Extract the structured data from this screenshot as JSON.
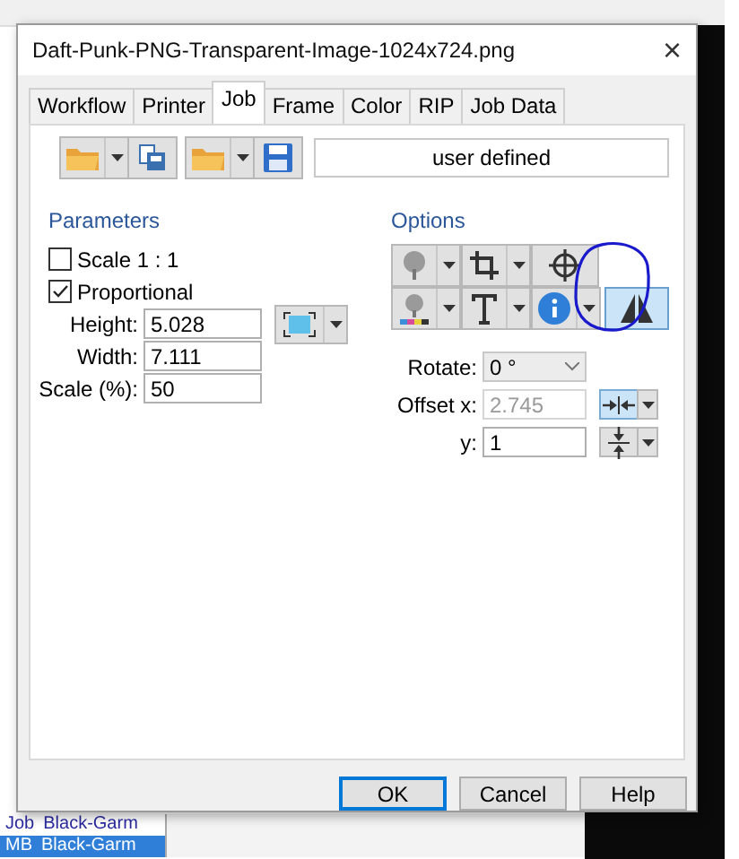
{
  "window": {
    "title": "Daft-Punk-PNG-Transparent-Image-1024x724.png",
    "close": "×"
  },
  "tabs": [
    {
      "label": "Workflow",
      "selected": false
    },
    {
      "label": "Printer",
      "selected": false
    },
    {
      "label": "Job",
      "selected": true
    },
    {
      "label": "Frame",
      "selected": false
    },
    {
      "label": "Color",
      "selected": false
    },
    {
      "label": "RIP",
      "selected": false
    },
    {
      "label": "Job Data",
      "selected": false
    }
  ],
  "preset_field": {
    "value": "user defined"
  },
  "parameters": {
    "title": "Parameters",
    "checkboxes": [
      {
        "label": "Scale 1 : 1",
        "checked": false
      },
      {
        "label": "Proportional",
        "checked": true
      }
    ],
    "fields": [
      {
        "label": "Height:",
        "value": "5.028"
      },
      {
        "label": "Width:",
        "value": "7.111"
      },
      {
        "label": "Scale (%):",
        "value": "50"
      }
    ]
  },
  "options": {
    "title": "Options",
    "mirror_pressed": true,
    "rotate": {
      "label": "Rotate:",
      "value": "0 °"
    },
    "offset_x": {
      "label": "Offset x:",
      "value": "2.745",
      "disabled": true,
      "align_pressed": true
    },
    "offset_y": {
      "label": "y:",
      "value": "1",
      "disabled": false,
      "align_pressed": false
    }
  },
  "buttons": [
    {
      "label": "OK",
      "selected": true
    },
    {
      "label": "Cancel",
      "selected": false
    },
    {
      "label": "Help",
      "selected": false
    }
  ],
  "background_list": [
    {
      "column_1": "Job",
      "column_2": "Black-Garm",
      "selected": false
    },
    {
      "column_1": "MB",
      "column_2": "Black-Garm",
      "selected": true
    }
  ]
}
